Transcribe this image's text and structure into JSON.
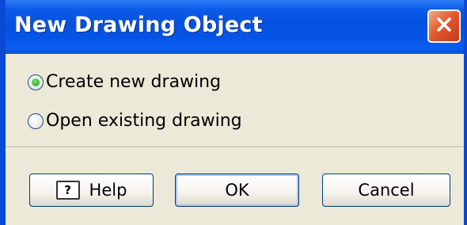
{
  "window": {
    "title": "New Drawing Object"
  },
  "options": [
    {
      "label": "Create new drawing",
      "selected": true
    },
    {
      "label": "Open existing drawing",
      "selected": false
    }
  ],
  "buttons": {
    "help": "Help",
    "ok": "OK",
    "cancel": "Cancel"
  },
  "icons": {
    "close": "close-icon",
    "help": "help-icon"
  },
  "colors": {
    "titlebar": "#0751df",
    "close_button": "#e25b2e",
    "dialog_bg": "#ece9d8",
    "radio_dot": "#21a121"
  }
}
